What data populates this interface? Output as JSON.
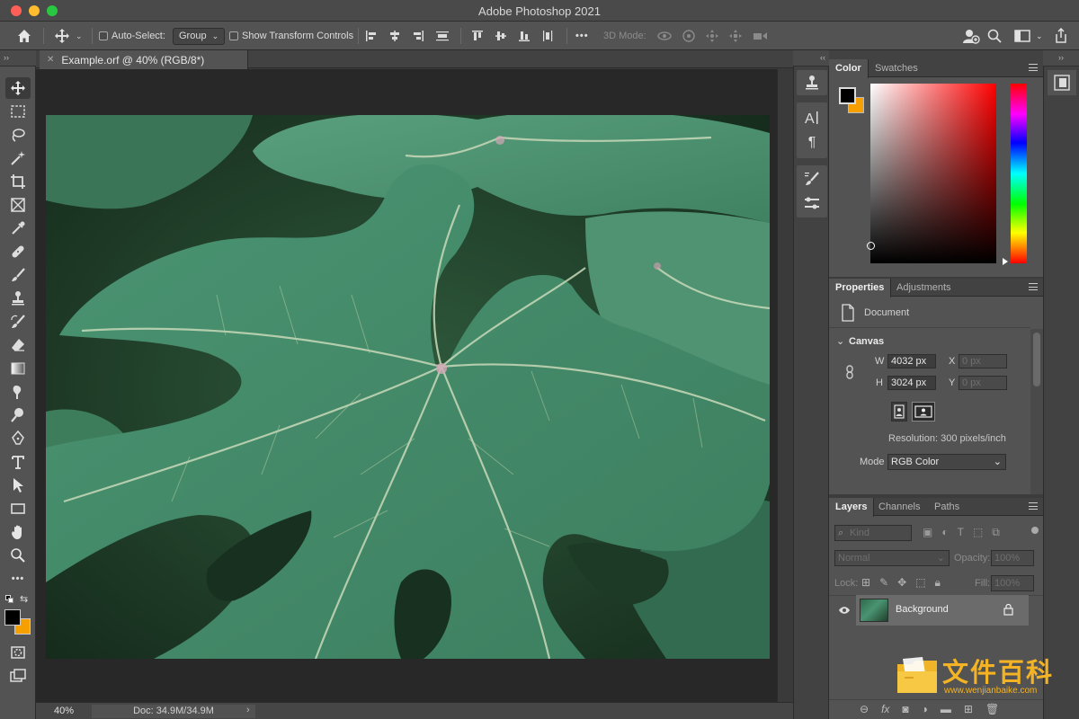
{
  "window": {
    "title": "Adobe Photoshop 2021"
  },
  "options_bar": {
    "auto_select_label": "Auto-Select:",
    "auto_select_value": "Group",
    "show_transform_label": "Show Transform Controls",
    "more": "•••",
    "mode3d_label": "3D Mode:"
  },
  "document": {
    "tab_title": "Example.orf @ 40% (RGB/8*)",
    "close_glyph": "✕",
    "zoom": "40%",
    "doc_info": "Doc: 34.9M/34.9M",
    "info_arrow": "›"
  },
  "color_panel": {
    "tabs": [
      "Color",
      "Swatches"
    ],
    "foreground": "#000000",
    "background": "#f5a000"
  },
  "properties_panel": {
    "tabs": [
      "Properties",
      "Adjustments"
    ],
    "doc_label": "Document",
    "section": "Canvas",
    "w_label": "W",
    "w_value": "4032 px",
    "h_label": "H",
    "h_value": "3024 px",
    "x_label": "X",
    "x_value": "0 px",
    "y_label": "Y",
    "y_value": "0 px",
    "resolution": "Resolution: 300 pixels/inch",
    "mode_label": "Mode",
    "mode_value": "RGB Color"
  },
  "layers_panel": {
    "tabs": [
      "Layers",
      "Channels",
      "Paths"
    ],
    "kind_placeholder": "Kind",
    "blend_mode": "Normal",
    "opacity_label": "Opacity:",
    "opacity_value": "100%",
    "lock_label": "Lock:",
    "fill_label": "Fill:",
    "fill_value": "100%",
    "layers": [
      {
        "name": "Background",
        "visible": true,
        "locked": true
      }
    ]
  },
  "watermark": {
    "cn": "文件百科",
    "url": "www.wenjianbaike.com"
  },
  "collapse_glyph": "››",
  "expand_glyph": "‹‹"
}
